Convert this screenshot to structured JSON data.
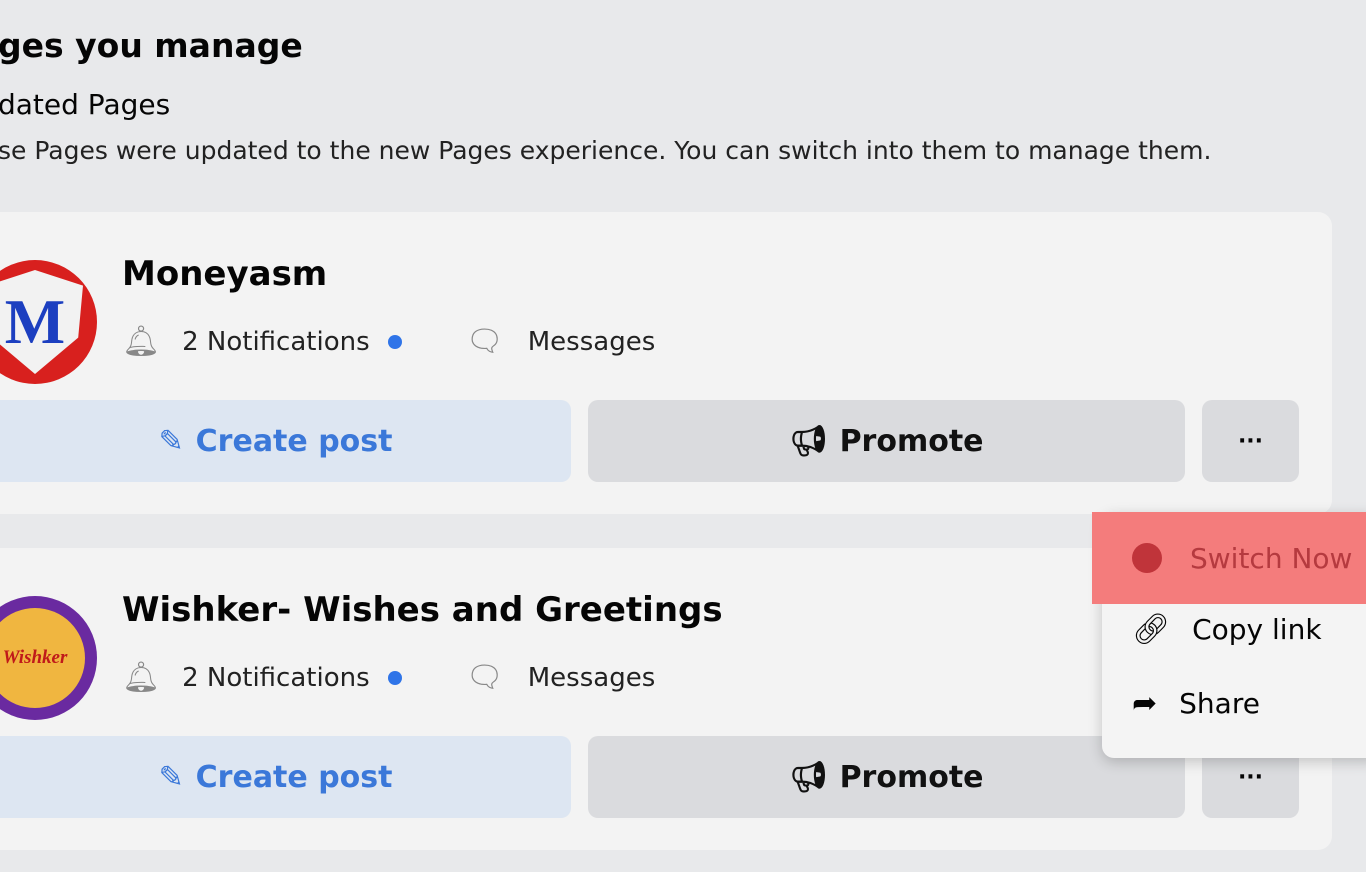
{
  "header": {
    "title": "ges you manage",
    "section": "dated Pages",
    "description": "se Pages were updated to the new Pages experience. You can switch into them to manage them."
  },
  "pages": [
    {
      "name": "Moneyasm",
      "notifications": "2 Notifications",
      "messages": "Messages",
      "create_post": "Create post",
      "promote": "Promote",
      "more": "···",
      "logo_text": "M"
    },
    {
      "name": "Wishker- Wishes and Greetings",
      "notifications": "2 Notifications",
      "messages": "Messages",
      "create_post": "Create post",
      "promote": "Promote",
      "more": "···",
      "logo_text": "Wishker"
    }
  ],
  "menu": {
    "items": [
      {
        "label": "Switch Now",
        "icon": "switch-profile-icon"
      },
      {
        "label": "Copy link",
        "icon": "link-icon"
      },
      {
        "label": "Share",
        "icon": "share-icon"
      }
    ]
  },
  "colors": {
    "accent": "#3b78d9",
    "highlight": "#f47c7c",
    "unread_dot": "#2f74e8"
  }
}
